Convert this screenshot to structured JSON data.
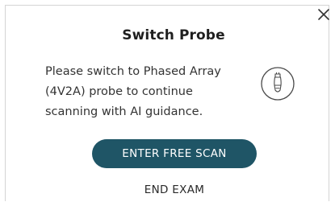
{
  "dialog": {
    "title": "Switch Probe",
    "message": "Please switch to Phased Array (4V2A) probe to continue scanning with AI guidance.",
    "primary_button_label": "ENTER FREE SCAN",
    "secondary_button_label": "END EXAM",
    "close_icon": "close-icon",
    "probe_icon": "probe-icon"
  },
  "colors": {
    "primary_button_bg": "#1f5566",
    "primary_button_text": "#ffffff",
    "border": "#d4d4d4"
  }
}
